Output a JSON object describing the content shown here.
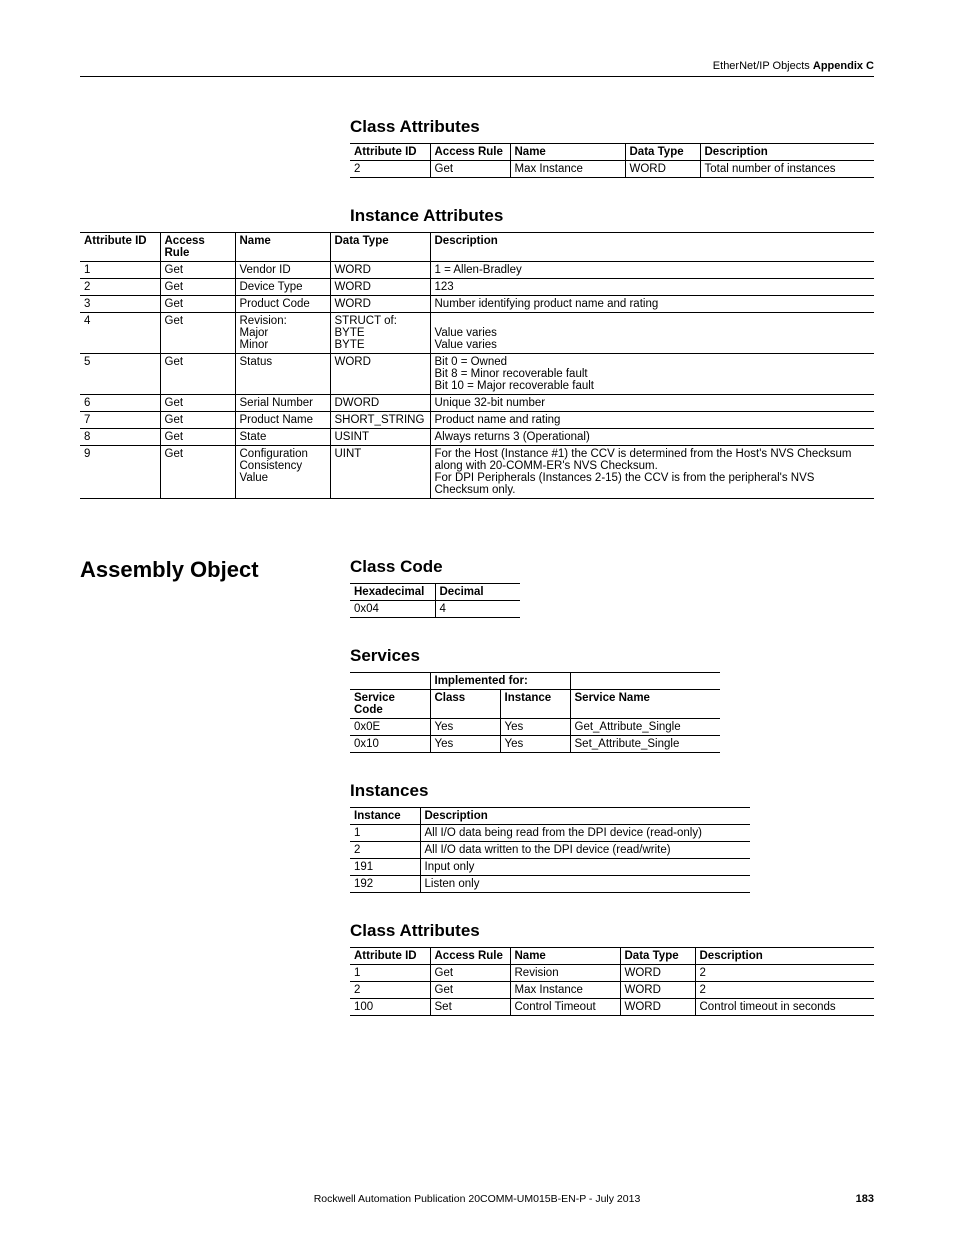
{
  "header": {
    "left": "EtherNet/IP Objects",
    "right": "Appendix C"
  },
  "section1": {
    "classAttrTitle": "Class Attributes",
    "classAttrHeaders": [
      "Attribute ID",
      "Access Rule",
      "Name",
      "Data Type",
      "Description"
    ],
    "classAttrRows": [
      [
        "2",
        "Get",
        "Max Instance",
        "WORD",
        "Total number of instances"
      ]
    ],
    "instAttrTitle": "Instance Attributes",
    "instAttrHeaders": [
      "Attribute ID",
      "Access Rule",
      "Name",
      "Data Type",
      "Description"
    ],
    "instAttrRows": [
      {
        "c": [
          "1",
          "Get",
          "Vendor ID",
          "WORD",
          "1 = Allen-Bradley"
        ]
      },
      {
        "c": [
          "2",
          "Get",
          "Device Type",
          "WORD",
          "123"
        ]
      },
      {
        "c": [
          "3",
          "Get",
          "Product Code",
          "WORD",
          "Number identifying product name and rating"
        ]
      },
      {
        "c": [
          "4",
          "Get",
          "Revision:\nMajor\nMinor",
          "STRUCT of:\nBYTE\nBYTE",
          "\nValue varies\nValue varies"
        ]
      },
      {
        "c": [
          "5",
          "Get",
          "Status",
          "WORD",
          "Bit 0 = Owned\nBit 8 = Minor recoverable fault\nBit 10 = Major recoverable fault"
        ]
      },
      {
        "c": [
          "6",
          "Get",
          "Serial Number",
          "DWORD",
          "Unique 32-bit number"
        ]
      },
      {
        "c": [
          "7",
          "Get",
          "Product Name",
          "SHORT_STRING",
          "Product name and rating"
        ]
      },
      {
        "c": [
          "8",
          "Get",
          "State",
          "USINT",
          "Always returns 3  (Operational)"
        ]
      },
      {
        "c": [
          "9",
          "Get",
          "Configuration Consistency Value",
          "UINT",
          "For the Host (Instance #1) the CCV is determined from the Host's NVS Checksum along with 20-COMM-ER's NVS Checksum.\nFor DPI Peripherals (Instances 2-15) the CCV is from the peripheral's NVS Checksum only."
        ]
      }
    ]
  },
  "assembly": {
    "title": "Assembly Object",
    "classCodeTitle": "Class Code",
    "classCodeHeaders": [
      "Hexadecimal",
      "Decimal"
    ],
    "classCodeRows": [
      [
        "0x04",
        "4"
      ]
    ],
    "servicesTitle": "Services",
    "servicesTopHeader": "Implemented for:",
    "servicesHeaders": [
      "Service Code",
      "Class",
      "Instance",
      "Service Name"
    ],
    "servicesRows": [
      [
        "0x0E",
        "Yes",
        "Yes",
        "Get_Attribute_Single"
      ],
      [
        "0x10",
        "Yes",
        "Yes",
        "Set_Attribute_Single"
      ]
    ],
    "instancesTitle": "Instances",
    "instancesHeaders": [
      "Instance",
      "Description"
    ],
    "instancesRows": [
      [
        "1",
        "All I/O data being read from the DPI device (read-only)"
      ],
      [
        "2",
        "All I/O data written to the DPI device (read/write)"
      ],
      [
        "191",
        "Input only"
      ],
      [
        "192",
        "Listen only"
      ]
    ],
    "classAttr2Title": "Class Attributes",
    "classAttr2Headers": [
      "Attribute ID",
      "Access Rule",
      "Name",
      "Data Type",
      "Description"
    ],
    "classAttr2Rows": [
      [
        "1",
        "Get",
        "Revision",
        "WORD",
        "2"
      ],
      [
        "2",
        "Get",
        "Max Instance",
        "WORD",
        "2"
      ],
      [
        "100",
        "Set",
        "Control Timeout",
        "WORD",
        "Control timeout in seconds"
      ]
    ]
  },
  "footer": {
    "text": "Rockwell Automation Publication  20COMM-UM015B-EN-P - July 2013",
    "page": "183"
  }
}
